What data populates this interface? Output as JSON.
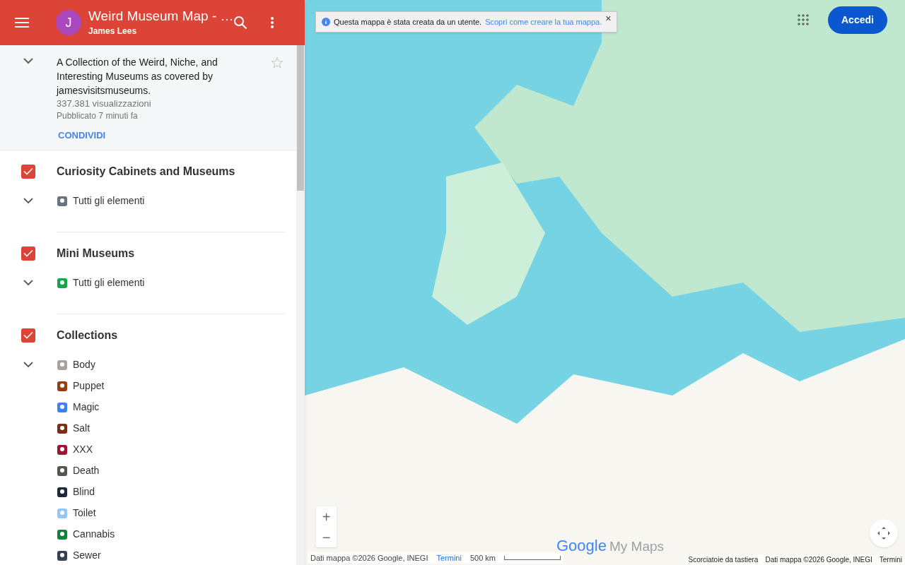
{
  "header": {
    "avatar": "J",
    "title": "Weird Museum Map - …",
    "author": "James Lees"
  },
  "info": {
    "expanded": true,
    "starred": false,
    "description": "A Collection of the Weird, Niche, and Interesting Museums as covered by jamesvisitsmuseums.",
    "views": "337.381 visualizzazioni",
    "published": "Pubblicato 7 minuti fa",
    "share": "CONDIVIDI"
  },
  "layers": [
    {
      "title": "Curiosity Cabinets and Museums",
      "checked": true,
      "expanded": true,
      "items": [
        {
          "label": "Tutti gli elementi",
          "color": "#6b7280"
        }
      ]
    },
    {
      "title": "Mini Museums",
      "checked": true,
      "expanded": true,
      "items": [
        {
          "label": "Tutti gli elementi",
          "color": "#16a34a"
        }
      ]
    },
    {
      "title": "Collections",
      "checked": true,
      "expanded": true,
      "items": [
        {
          "label": "Body",
          "color": "#a8a29e"
        },
        {
          "label": "Puppet",
          "color": "#92400e"
        },
        {
          "label": "Magic",
          "color": "#3b82f6"
        },
        {
          "label": "Salt",
          "color": "#7c2d12"
        },
        {
          "label": "XXX",
          "color": "#9f1239"
        },
        {
          "label": "Death",
          "color": "#57534e"
        },
        {
          "label": "Blind",
          "color": "#1f2937"
        },
        {
          "label": "Toilet",
          "color": "#93c5fd"
        },
        {
          "label": "Cannabis",
          "color": "#15803d"
        },
        {
          "label": "Sewer",
          "color": "#374151"
        }
      ]
    }
  ],
  "map": {
    "notice": "Questa mappa è stata creata da un utente.",
    "notice_link": "Scopri come creare la tua mappa.",
    "close": "×",
    "sign_in": "Accedi",
    "zoom_in": "+",
    "zoom_out": "−",
    "logo_google": "Google",
    "logo_product": "My Maps",
    "attribution_left": "Dati mappa ©2026 Google, INEGI",
    "terms_left": "Termini",
    "scale": "500 km",
    "shortcuts": "Scorciatoie da tastiera",
    "attribution_right": "Dati mappa ©2026 Google, INEGI",
    "terms_right": "Termini"
  }
}
